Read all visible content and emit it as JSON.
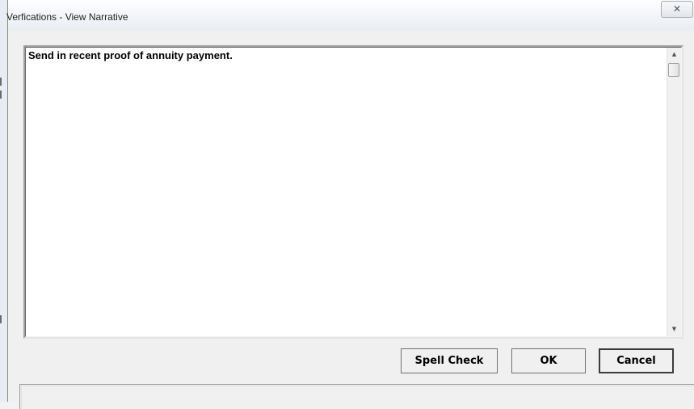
{
  "window": {
    "title": "Verfications - View Narrative",
    "close_glyph": "✕"
  },
  "narrative": {
    "text": "Send in recent proof of annuity payment."
  },
  "scrollbar": {
    "up_glyph": "▲",
    "down_glyph": "▼"
  },
  "buttons": {
    "spell_check": "Spell Check",
    "ok": "OK",
    "cancel": "Cancel"
  }
}
